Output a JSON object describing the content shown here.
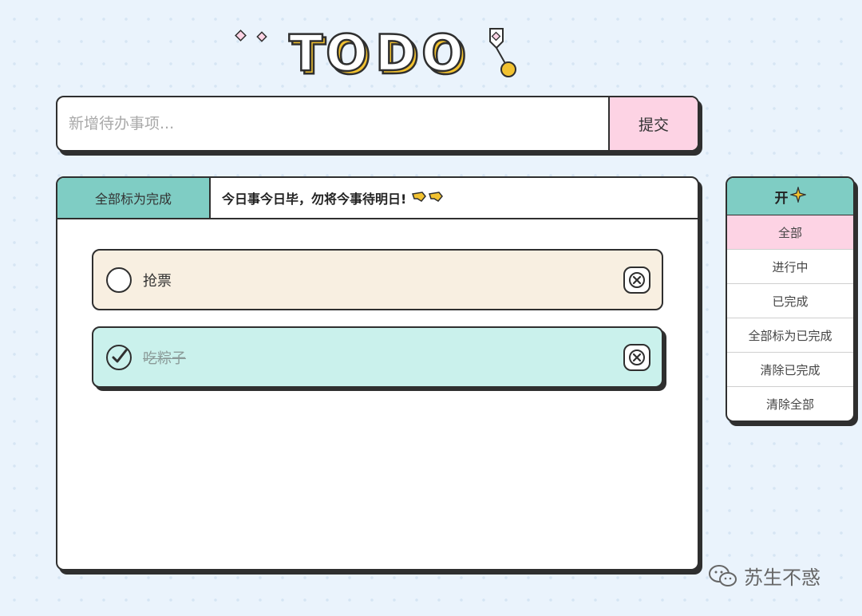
{
  "header": {
    "logo_text": "TODO"
  },
  "input": {
    "placeholder": "新增待办事项...",
    "value": "",
    "submit_label": "提交"
  },
  "main": {
    "mark_all_label": "全部标为完成",
    "motto": "今日事今日毕，勿将今事待明日!"
  },
  "todos": [
    {
      "text": "抢票",
      "done": false
    },
    {
      "text": "吃粽子",
      "done": true
    }
  ],
  "side_panel": {
    "title": "开",
    "active_filter": "全部",
    "items": [
      "全部",
      "进行中",
      "已完成",
      "全部标为已完成",
      "清除已完成",
      "清除全部"
    ]
  },
  "watermark": {
    "text": "苏生不惑"
  },
  "colors": {
    "teal": "#7fcdc4",
    "pink": "#fdd3e4",
    "cream": "#f8efe1",
    "mint": "#caf1ec",
    "yellow": "#f2c230",
    "border": "#2f2f2f",
    "background": "#eaf3fc"
  },
  "icons": {
    "check": "check-icon",
    "close": "close-icon",
    "sparkle": "sparkle-icon",
    "pointing_hands": "pointing-hand-icon"
  }
}
